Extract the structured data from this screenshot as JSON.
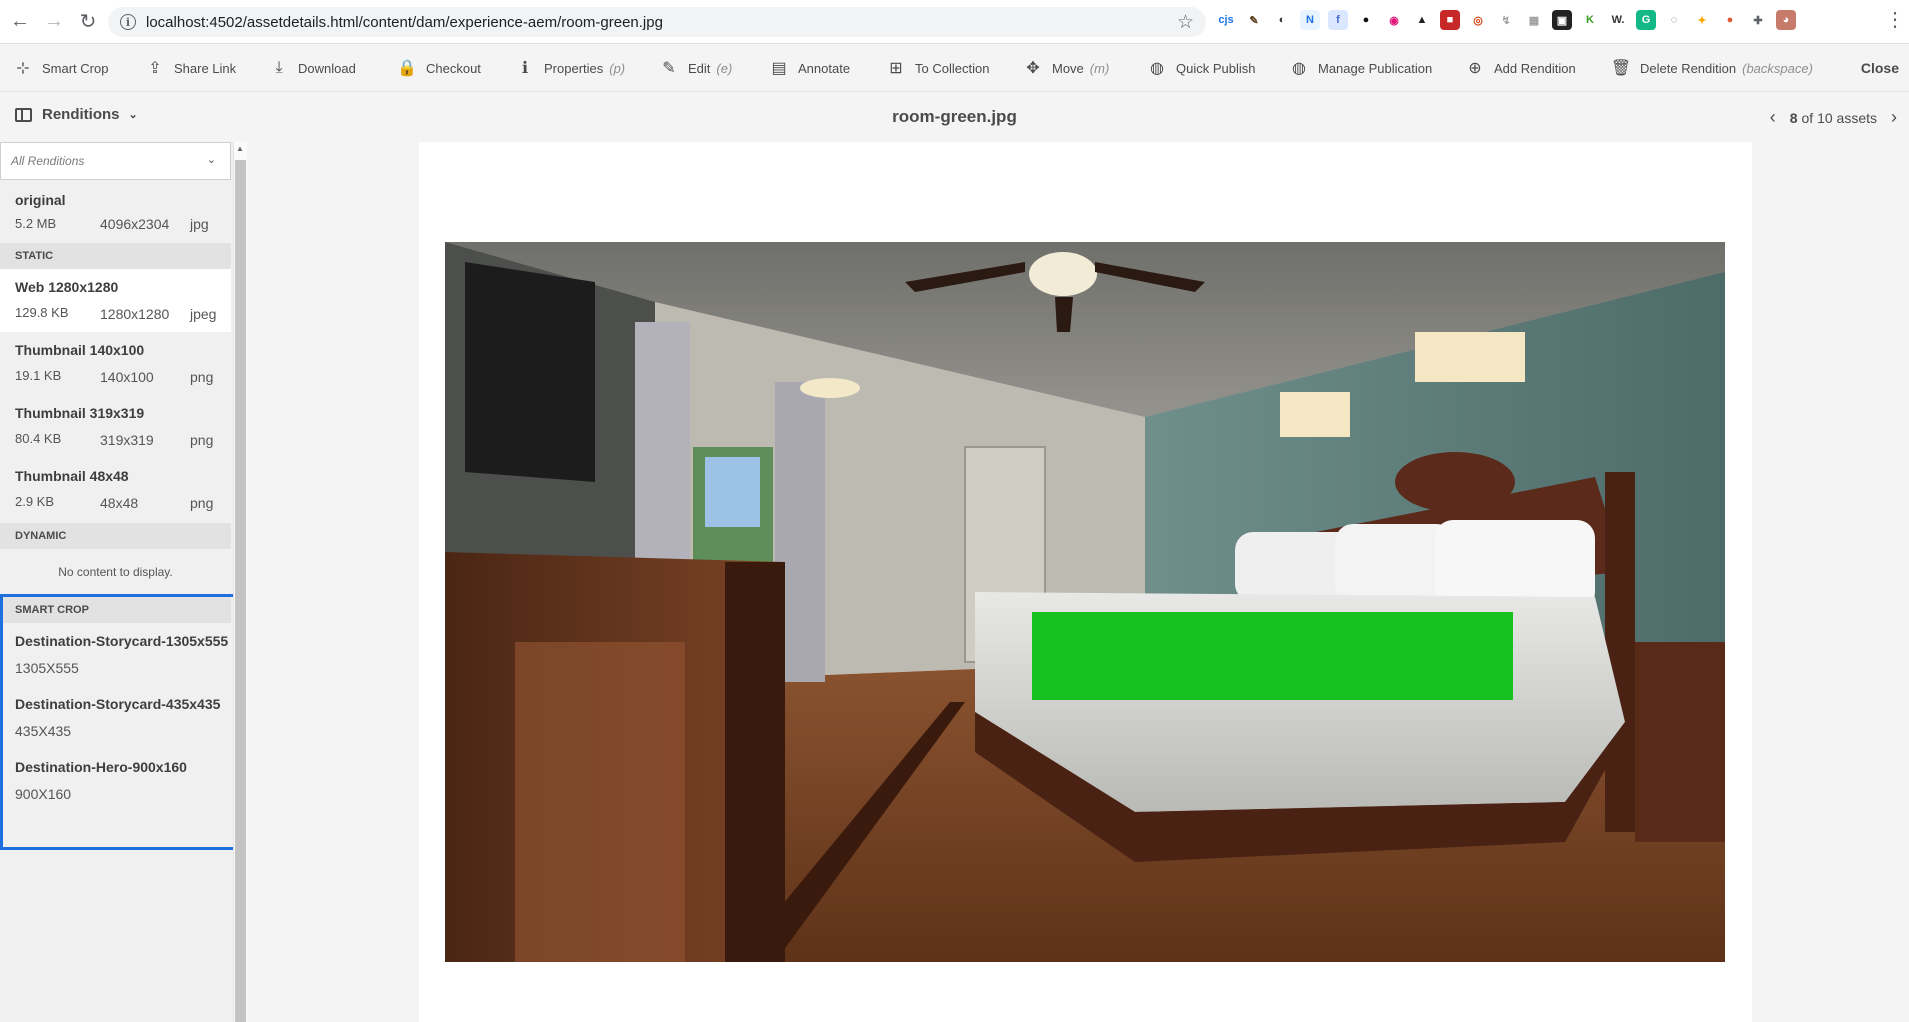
{
  "browser": {
    "url": "localhost:4502/assetdetails.html/content/dam/experience-aem/room-green.jpg",
    "extensions": [
      {
        "name": "cjs",
        "label": "cjs",
        "color": "#ffffff",
        "text": "#1a73e8"
      },
      {
        "name": "brush",
        "label": "✎",
        "color": "#ffffff",
        "text": "#5a3e1b"
      },
      {
        "name": "circle",
        "label": "◐",
        "color": "#ffffff",
        "text": "#333333"
      },
      {
        "name": "n-ext",
        "label": "N",
        "color": "#e8f4ff",
        "text": "#1a73e8"
      },
      {
        "name": "f-ext",
        "label": "f",
        "color": "#dbe6ff",
        "text": "#4a6ad0"
      },
      {
        "name": "spy",
        "label": "●",
        "color": "#ffffff",
        "text": "#111111"
      },
      {
        "name": "pink",
        "label": "◉",
        "color": "#ffffff",
        "text": "#e0187a"
      },
      {
        "name": "tri",
        "label": "▲",
        "color": "#ffffff",
        "text": "#222222"
      },
      {
        "name": "red-sq",
        "label": "■",
        "color": "#c62828",
        "text": "#ffffff"
      },
      {
        "name": "ring",
        "label": "◎",
        "color": "#ffffff",
        "text": "#d84315"
      },
      {
        "name": "leaf",
        "label": "↯",
        "color": "#ffffff",
        "text": "#9e9e9e"
      },
      {
        "name": "box",
        "label": "▦",
        "color": "#ffffff",
        "text": "#9e9e9e"
      },
      {
        "name": "grid",
        "label": "▣",
        "color": "#222222",
        "text": "#ffffff"
      },
      {
        "name": "k-ext",
        "label": "K",
        "color": "#ffffff",
        "text": "#3a9d23"
      },
      {
        "name": "w-ext",
        "label": "W.",
        "color": "#ffffff",
        "text": "#333333"
      },
      {
        "name": "g-ext",
        "label": "G",
        "color": "#12b886",
        "text": "#ffffff"
      },
      {
        "name": "ring2",
        "label": "◌",
        "color": "#ffffff",
        "text": "#5f6368"
      },
      {
        "name": "bulb",
        "label": "✦",
        "color": "#ffffff",
        "text": "#f6a700"
      },
      {
        "name": "duck",
        "label": "●",
        "color": "#ffffff",
        "text": "#de5833"
      },
      {
        "name": "puzzle",
        "label": "✚",
        "color": "#ffffff",
        "text": "#5f6368"
      },
      {
        "name": "profile",
        "label": "◕",
        "color": "#c77b6a",
        "text": "#ffffff"
      }
    ]
  },
  "toolbar": {
    "items": [
      {
        "label": "Smart Crop",
        "icon": "smart-crop-icon",
        "glyph": "⊹",
        "kbd": ""
      },
      {
        "label": "Share Link",
        "icon": "share-icon",
        "glyph": "⇪",
        "kbd": ""
      },
      {
        "label": "Download",
        "icon": "download-icon",
        "glyph": "⤓",
        "kbd": ""
      },
      {
        "label": "Checkout",
        "icon": "lock-icon",
        "glyph": "🔒",
        "kbd": ""
      },
      {
        "label": "Properties",
        "icon": "info-icon",
        "glyph": "ℹ",
        "kbd": "(p)"
      },
      {
        "label": "Edit",
        "icon": "pencil-icon",
        "glyph": "✎",
        "kbd": "(e)"
      },
      {
        "label": "Annotate",
        "icon": "comment-icon",
        "glyph": "▤",
        "kbd": ""
      },
      {
        "label": "To Collection",
        "icon": "collection-icon",
        "glyph": "⊞",
        "kbd": ""
      },
      {
        "label": "Move",
        "icon": "move-icon",
        "glyph": "✥",
        "kbd": "(m)"
      },
      {
        "label": "Quick Publish",
        "icon": "globe-icon",
        "glyph": "◍",
        "kbd": ""
      },
      {
        "label": "Manage Publication",
        "icon": "publication-icon",
        "glyph": "◍",
        "kbd": ""
      },
      {
        "label": "Add Rendition",
        "icon": "add-icon",
        "glyph": "⊕",
        "kbd": ""
      },
      {
        "label": "Delete Rendition",
        "icon": "trash-icon",
        "glyph": "🗑",
        "kbd": "(backspace)"
      }
    ],
    "close_label": "Close"
  },
  "header": {
    "rail_label": "Renditions",
    "title": "room-green.jpg",
    "pager_current": "8",
    "pager_rest": "of 10 assets"
  },
  "rail": {
    "filter_placeholder": "All Renditions",
    "original": {
      "name": "original",
      "size": "5.2 MB",
      "dim": "4096x2304",
      "type": "jpg"
    },
    "static_label": "STATIC",
    "static": [
      {
        "name": "Web 1280x1280",
        "size": "129.8 KB",
        "dim": "1280x1280",
        "type": "jpeg"
      },
      {
        "name": "Thumbnail 140x100",
        "size": "19.1 KB",
        "dim": "140x100",
        "type": "png"
      },
      {
        "name": "Thumbnail 319x319",
        "size": "80.4 KB",
        "dim": "319x319",
        "type": "png"
      },
      {
        "name": "Thumbnail 48x48",
        "size": "2.9 KB",
        "dim": "48x48",
        "type": "png"
      }
    ],
    "dynamic_label": "DYNAMIC",
    "dynamic_empty": "No content to display.",
    "smart_crop_label": "SMART CROP",
    "smart_crop": [
      {
        "name": "Destination-Storycard-1305x555",
        "dim": "1305X555"
      },
      {
        "name": "Destination-Storycard-435x435",
        "dim": "435X435"
      },
      {
        "name": "Destination-Hero-900x160",
        "dim": "900X160"
      }
    ]
  },
  "colors": {
    "accent": "#1f6fde",
    "green_box": "#16c21f"
  }
}
